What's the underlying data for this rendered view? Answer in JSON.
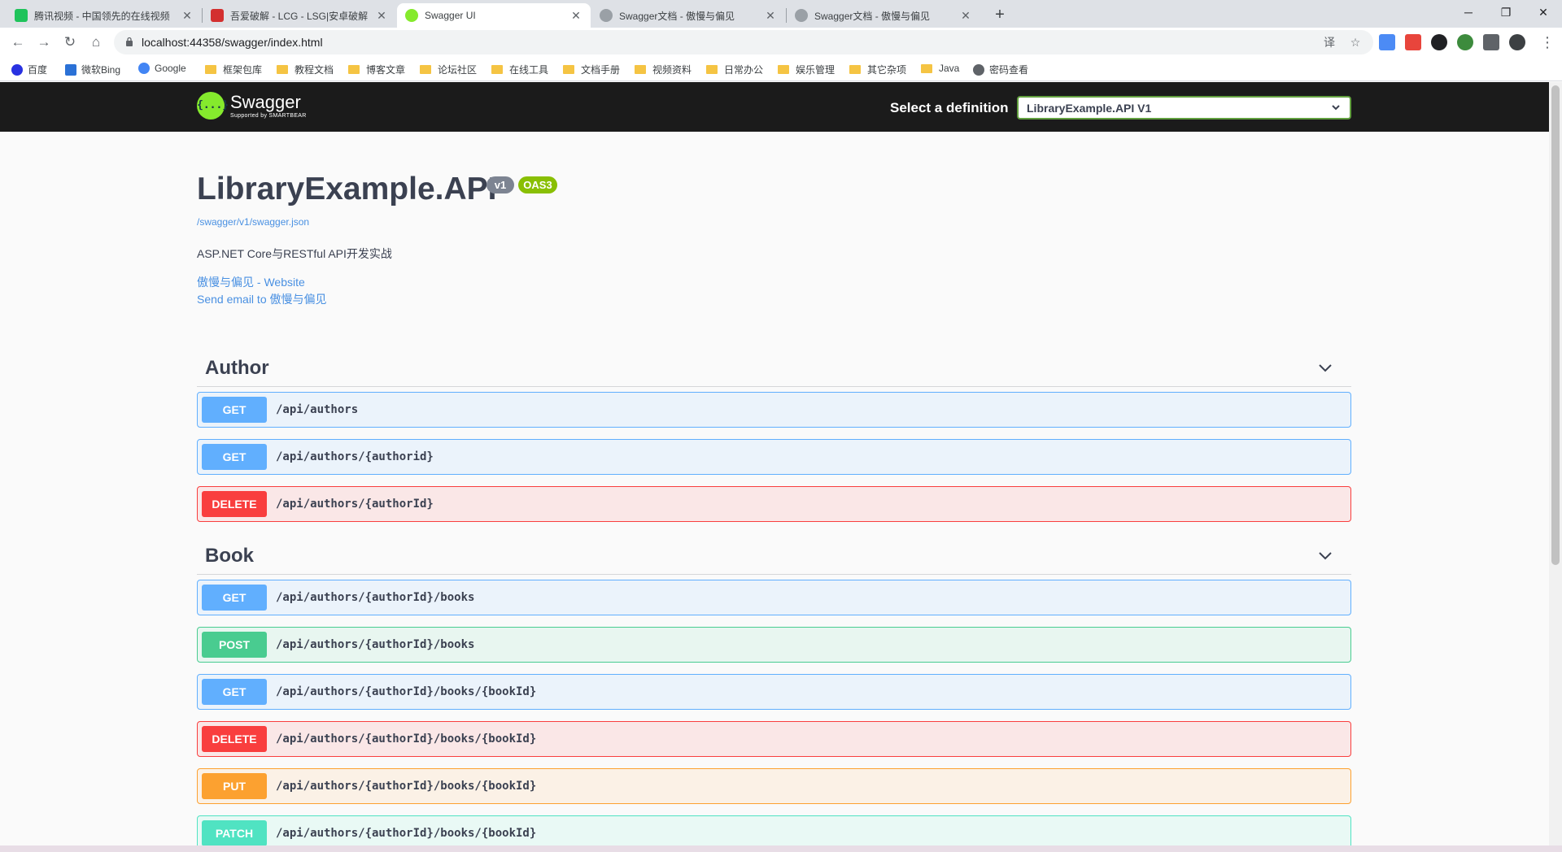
{
  "browser": {
    "tabs": [
      {
        "title": "腾讯视频 - 中国领先的在线视频",
        "active": false
      },
      {
        "title": "吾爱破解 - LCG - LSG|安卓破解",
        "active": false
      },
      {
        "title": "Swagger UI",
        "active": true
      },
      {
        "title": "Swagger文档 - 傲慢与偏见",
        "active": false
      },
      {
        "title": "Swagger文档 - 傲慢与偏见",
        "active": false
      }
    ],
    "new_tab": "+",
    "controls": {
      "minimize": "─",
      "maximize": "❐",
      "close": "✕"
    },
    "nav": {
      "back": "←",
      "forward": "→",
      "reload": "↻",
      "home": "⌂"
    },
    "url": "localhost:44358/swagger/index.html",
    "omnibox_icons": {
      "translate": "译",
      "star": "☆"
    },
    "menu": "⋮",
    "bookmarks": [
      {
        "label": "百度",
        "icon": "baidu-icon"
      },
      {
        "label": "微软Bing",
        "icon": "bing-icon"
      },
      {
        "label": "Google",
        "icon": "google-icon"
      },
      {
        "label": "框架包库",
        "icon": "folder-icon"
      },
      {
        "label": "教程文档",
        "icon": "folder-icon"
      },
      {
        "label": "博客文章",
        "icon": "folder-icon"
      },
      {
        "label": "论坛社区",
        "icon": "folder-icon"
      },
      {
        "label": "在线工具",
        "icon": "folder-icon"
      },
      {
        "label": "文档手册",
        "icon": "folder-icon"
      },
      {
        "label": "视频资料",
        "icon": "folder-icon"
      },
      {
        "label": "日常办公",
        "icon": "folder-icon"
      },
      {
        "label": "娱乐管理",
        "icon": "folder-icon"
      },
      {
        "label": "其它杂项",
        "icon": "folder-icon"
      },
      {
        "label": "Java",
        "icon": "folder-icon"
      },
      {
        "label": "密码查看",
        "icon": "globe-icon"
      }
    ]
  },
  "swagger": {
    "logo_symbol": "{...}",
    "logo_name": "Swagger",
    "logo_sub": "Supported by SMARTBEAR",
    "select_label": "Select a definition",
    "select_value": "LibraryExample.API V1",
    "title": "LibraryExample.API",
    "version_badge": "v1",
    "oas_badge": "OAS3",
    "spec_url": "/swagger/v1/swagger.json",
    "description": "ASP.NET Core与RESTful API开发实战",
    "contact_website": "傲慢与偏见 - Website",
    "contact_email": "Send email to 傲慢与偏见"
  },
  "tags": [
    {
      "name": "Author",
      "operations": [
        {
          "method": "GET",
          "path": "/api/authors"
        },
        {
          "method": "GET",
          "path": "/api/authors/{authorid}"
        },
        {
          "method": "DELETE",
          "path": "/api/authors/{authorId}"
        }
      ]
    },
    {
      "name": "Book",
      "operations": [
        {
          "method": "GET",
          "path": "/api/authors/{authorId}/books"
        },
        {
          "method": "POST",
          "path": "/api/authors/{authorId}/books"
        },
        {
          "method": "GET",
          "path": "/api/authors/{authorId}/books/{bookId}"
        },
        {
          "method": "DELETE",
          "path": "/api/authors/{authorId}/books/{bookId}"
        },
        {
          "method": "PUT",
          "path": "/api/authors/{authorId}/books/{bookId}"
        },
        {
          "method": "PATCH",
          "path": "/api/authors/{authorId}/books/{bookId}"
        }
      ]
    }
  ],
  "colors": {
    "get": "#61affe",
    "post": "#49cc90",
    "delete": "#f93e3e",
    "put": "#fca130",
    "patch": "#50e3c2",
    "swagger_green": "#85ea2d",
    "topbar": "#1b1b1b",
    "link": "#4990e2",
    "text": "#3b4151"
  }
}
